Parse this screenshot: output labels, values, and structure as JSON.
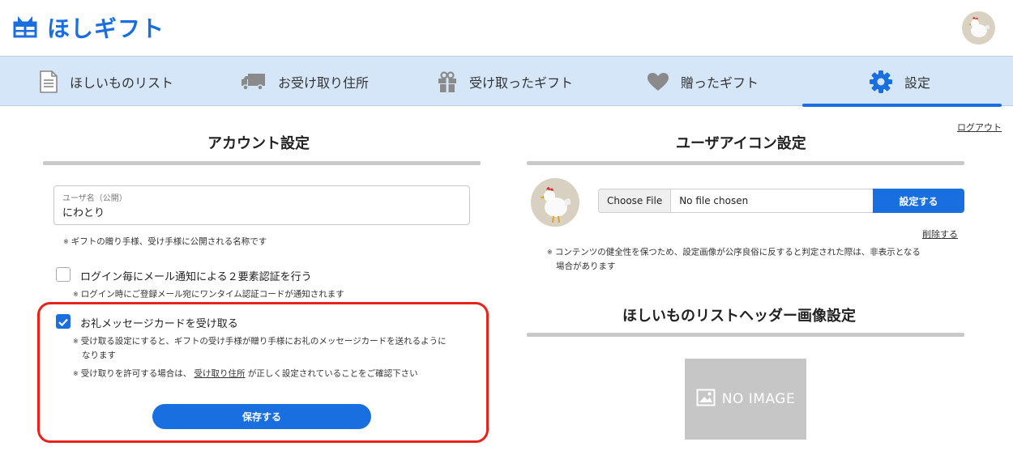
{
  "header": {
    "brand": "ほしギフト",
    "logo_icon": "gift-box-icon",
    "user_avatar": "chicken-avatar"
  },
  "nav": {
    "items": [
      {
        "label": "ほしいものリスト",
        "icon": "document-list-icon"
      },
      {
        "label": "お受け取り住所",
        "icon": "truck-icon"
      },
      {
        "label": "受け取ったギフト",
        "icon": "gift-icon"
      },
      {
        "label": "贈ったギフト",
        "icon": "heart-icon"
      },
      {
        "label": "設定",
        "icon": "gear-icon",
        "active": true
      }
    ]
  },
  "logout_label": "ログアウト",
  "account": {
    "title": "アカウント設定",
    "username_label": "ユーザ名（公開）",
    "username_value": "にわとり",
    "username_note": "ギフトの贈り手様、受け手様に公開される名称です",
    "twofa_label": "ログイン毎にメール通知による２要素認証を行う",
    "twofa_checked": false,
    "twofa_note": "ログイン時にご登録メール宛にワンタイム認証コードが通知されます",
    "card_label": "お礼メッセージカードを受け取る",
    "card_checked": true,
    "card_note1_line1": "受け取る設定にすると、ギフトの受け手様が贈り手様にお礼のメッセージカードを送れるように",
    "card_note1_line2": "なります",
    "card_note2_prefix": "受け取りを許可する場合は、",
    "card_note2_link": "受け取り住所",
    "card_note2_suffix": "が正しく設定されていることをご確認下さい",
    "save_label": "保存する",
    "note_mark": "※"
  },
  "icon_settings": {
    "title": "ユーザアイコン設定",
    "choose_file_label": "Choose File",
    "file_status": "No file chosen",
    "set_label": "設定する",
    "delete_label": "削除する",
    "note_line1": "コンテンツの健全性を保つため、設定画像が公序良俗に反すると判定された際は、非表示となる",
    "note_line2": "場合があります"
  },
  "header_image": {
    "title": "ほしいものリストヘッダー画像設定",
    "placeholder_label": "NO IMAGE"
  },
  "colors": {
    "accent": "#1a6fe0",
    "nav_bg": "#d5e6f9",
    "highlight": "#e8231c"
  }
}
